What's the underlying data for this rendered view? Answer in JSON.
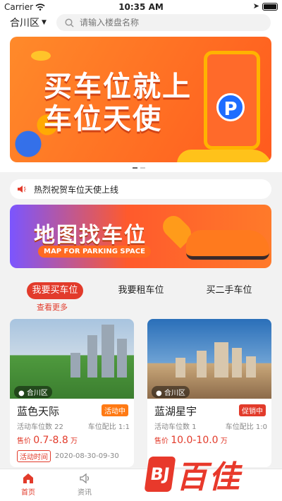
{
  "status": {
    "carrier": "Carrier",
    "time": "10:35 AM"
  },
  "header": {
    "city": "合川区",
    "search_placeholder": "请输入楼盘名称"
  },
  "banner": {
    "line1": "买车位就上",
    "line2": "车位天使",
    "p_label": "P"
  },
  "notice": {
    "text": "热烈祝贺车位天使上线"
  },
  "map_banner": {
    "title": "地图找车位",
    "subtitle": "MAP FOR PARKING SPACE"
  },
  "tabs": [
    {
      "label": "我要买车位",
      "active": true
    },
    {
      "label": "我要租车位",
      "active": false
    },
    {
      "label": "买二手车位",
      "active": false
    }
  ],
  "more_label": "查看更多",
  "cards": [
    {
      "location": "合川区",
      "name": "蓝色天际",
      "badge": "活动中",
      "activity_count": "活动车位数 22",
      "ratio": "车位配比 1:1",
      "price_prefix": "售价",
      "price": "0.7-8.8",
      "price_unit": "万",
      "time_label": "活动时间",
      "time_value": "2020-08-30-09-30"
    },
    {
      "location": "合川区",
      "name": "蓝湖星宇",
      "badge": "促销中",
      "activity_count": "活动车位数 1",
      "ratio": "车位配比 1:0",
      "price_prefix": "售价",
      "price": "10.0-10.0",
      "price_unit": "万"
    }
  ],
  "tabbar": [
    {
      "label": "首页",
      "icon": "home-icon",
      "active": true
    },
    {
      "label": "资讯",
      "icon": "speaker-icon",
      "active": false
    }
  ],
  "watermark": {
    "logo": "BJ",
    "brand": "百佳"
  },
  "colors": {
    "accent": "#e23b2b",
    "orange": "#ff7a14"
  }
}
